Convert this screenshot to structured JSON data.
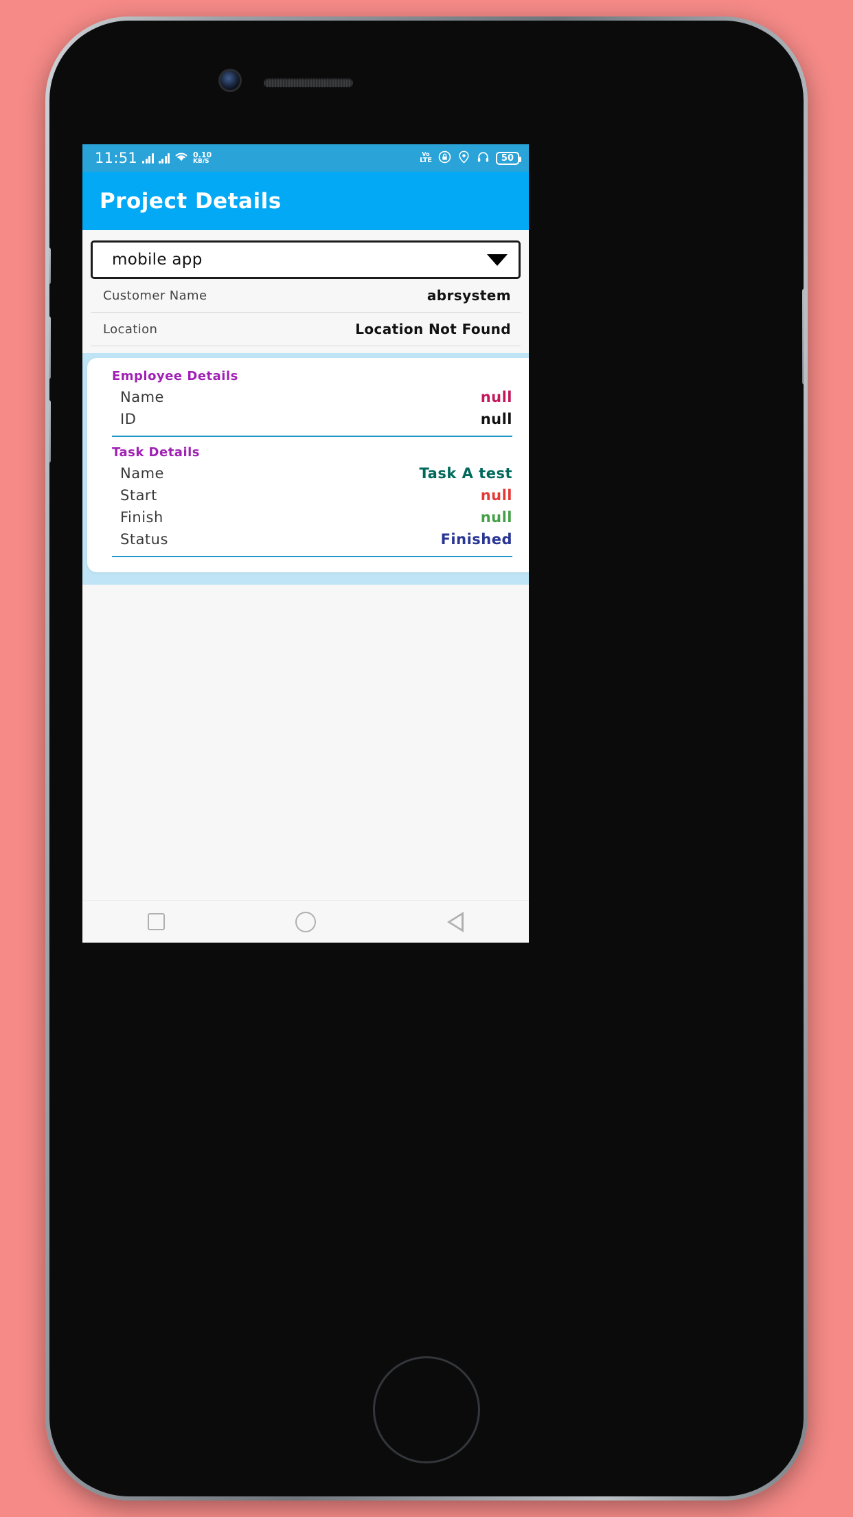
{
  "statusbar": {
    "time": "11:51",
    "net_speed_value": "0.10",
    "net_speed_unit": "KB/S",
    "volte_top": "Vo",
    "volte_bottom": "LTE",
    "battery": "50",
    "icons": [
      "signal-bars-icon",
      "signal-bars-icon",
      "wifi-icon",
      "volte-icon",
      "rotation-lock-icon",
      "location-icon",
      "headphones-icon",
      "battery-icon"
    ]
  },
  "appbar": {
    "title": "Project Details"
  },
  "spinner": {
    "selected": "mobile app",
    "caret": "chevron-down-icon"
  },
  "info_rows": [
    {
      "label": "Customer Name",
      "value": "abrsystem"
    },
    {
      "label": "Location",
      "value": "Location Not Found"
    }
  ],
  "employee_section": {
    "title": "Employee Details",
    "rows": [
      {
        "key": "Name",
        "value": "null",
        "color": "#c2185b"
      },
      {
        "key": "ID",
        "value": "null",
        "color": "#111111"
      }
    ]
  },
  "task_section": {
    "title": "Task Details",
    "rows": [
      {
        "key": "Name",
        "value": "Task A test",
        "color": "#00695c"
      },
      {
        "key": "Start",
        "value": "null",
        "color": "#e53935"
      },
      {
        "key": "Finish",
        "value": "null",
        "color": "#43a047"
      },
      {
        "key": "Status",
        "value": "Finished",
        "color": "#283593"
      }
    ]
  },
  "navbar": {
    "recents": "square-recents-icon",
    "home": "circle-home-icon",
    "back": "triangle-back-icon"
  },
  "colors": {
    "background": "#f58a87",
    "statusbar": "#2aa3d8",
    "appbar": "#03a9f4",
    "card_band": "#bfe4f5",
    "section_title": "#a01fb5",
    "divider_blue": "#2196c9"
  }
}
